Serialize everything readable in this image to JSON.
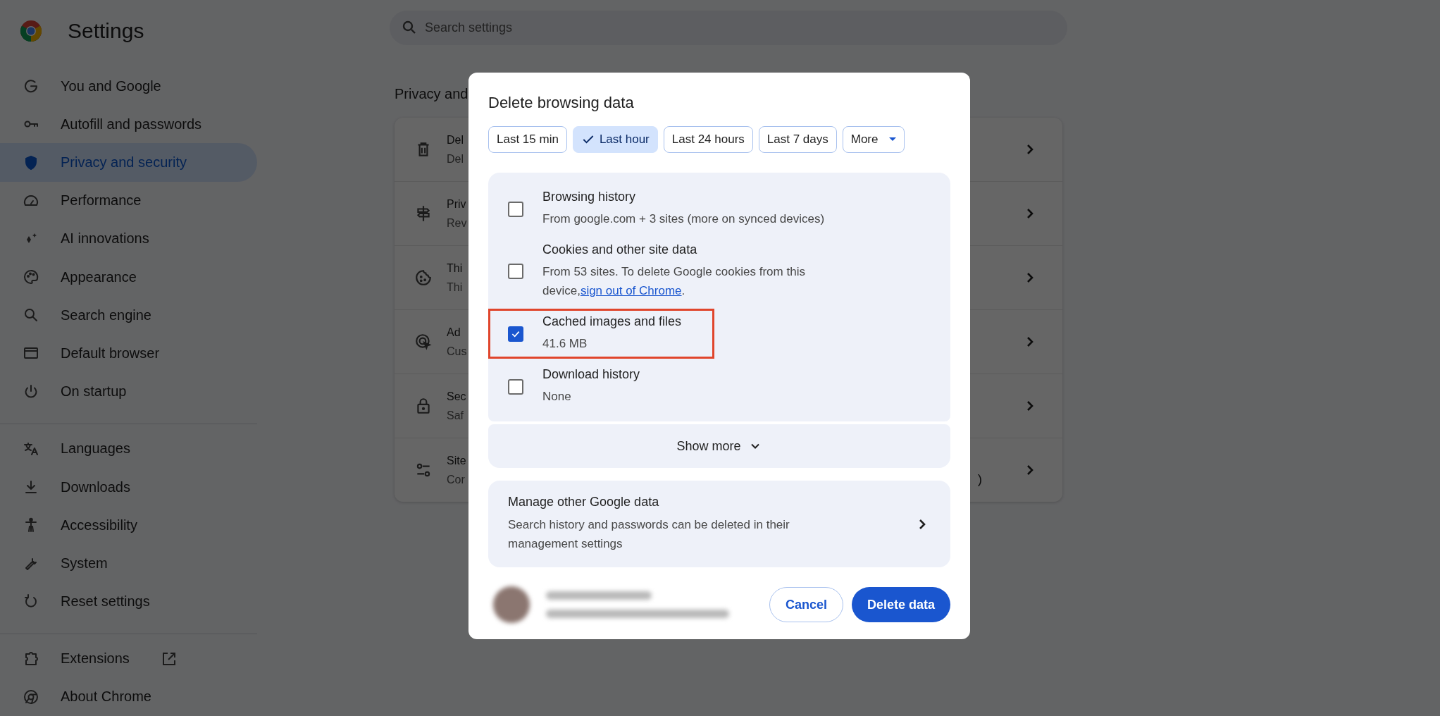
{
  "app": {
    "title": "Settings"
  },
  "search": {
    "placeholder": "Search settings"
  },
  "sidebar": {
    "groups": [
      [
        {
          "label": "You and Google",
          "selected": false
        },
        {
          "label": "Autofill and passwords",
          "selected": false
        },
        {
          "label": "Privacy and security",
          "selected": true
        },
        {
          "label": "Performance",
          "selected": false
        },
        {
          "label": "AI innovations",
          "selected": false
        },
        {
          "label": "Appearance",
          "selected": false
        },
        {
          "label": "Search engine",
          "selected": false
        },
        {
          "label": "Default browser",
          "selected": false
        },
        {
          "label": "On startup",
          "selected": false
        }
      ],
      [
        {
          "label": "Languages",
          "selected": false
        },
        {
          "label": "Downloads",
          "selected": false
        },
        {
          "label": "Accessibility",
          "selected": false
        },
        {
          "label": "System",
          "selected": false
        },
        {
          "label": "Reset settings",
          "selected": false
        }
      ],
      [
        {
          "label": "Extensions",
          "selected": false,
          "external": true
        },
        {
          "label": "About Chrome",
          "selected": false
        }
      ]
    ]
  },
  "section": {
    "heading": "Privacy and",
    "rows": [
      {
        "title": "Del",
        "subtitle": "Del"
      },
      {
        "title": "Priv",
        "subtitle": "Rev"
      },
      {
        "title": "Thi",
        "subtitle": "Thi"
      },
      {
        "title": "Ad",
        "subtitle": "Cus"
      },
      {
        "title": "Sec",
        "subtitle": "Saf"
      },
      {
        "title": "Site",
        "subtitle": "Cor",
        "trailing": ")"
      }
    ]
  },
  "dialog": {
    "title": "Delete browsing data",
    "ranges": [
      {
        "label": "Last 15 min",
        "selected": false,
        "kind": "chip"
      },
      {
        "label": "Last hour",
        "selected": true,
        "kind": "chip"
      },
      {
        "label": "Last 24 hours",
        "selected": false,
        "kind": "chip"
      },
      {
        "label": "Last 7 days",
        "selected": false,
        "kind": "chip"
      },
      {
        "label": "More",
        "selected": false,
        "kind": "dropdown"
      }
    ],
    "options": [
      {
        "label": "Browsing history",
        "detail": "From google.com + 3 sites (more on synced devices)",
        "checked": false,
        "highlighted": false
      },
      {
        "label": "Cookies and other site data",
        "detail": "From 53 sites. To delete Google cookies from this device,",
        "link": "sign out of Chrome",
        "detail_end": ".",
        "checked": false,
        "highlighted": false
      },
      {
        "label": "Cached images and files",
        "detail": "41.6 MB",
        "checked": true,
        "highlighted": true
      },
      {
        "label": "Download history",
        "detail": "None",
        "checked": false,
        "highlighted": false
      }
    ],
    "show_more": "Show more",
    "manage": {
      "title": "Manage other Google data",
      "detail": "Search history and passwords can be deleted in their management settings"
    },
    "buttons": [
      {
        "label": "Cancel",
        "kind": "secondary"
      },
      {
        "label": "Delete data",
        "kind": "primary"
      }
    ]
  }
}
